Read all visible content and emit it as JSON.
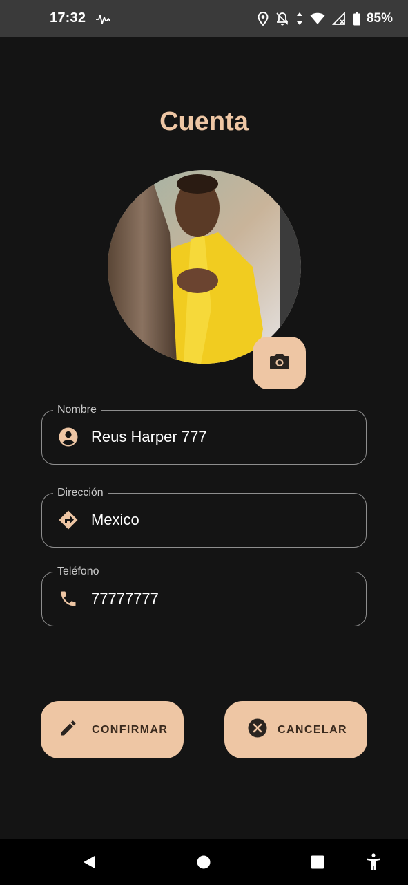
{
  "status_bar": {
    "time": "17:32",
    "battery": "85%",
    "icons": [
      "activity-icon",
      "location-icon",
      "notifications-off-icon",
      "data-arrows-icon",
      "wifi-icon",
      "signal-icon",
      "battery-icon"
    ]
  },
  "page": {
    "title": "Cuenta",
    "avatar_alt": "profile-photo",
    "camera_icon": "camera-icon"
  },
  "form": {
    "nombre": {
      "label": "Nombre",
      "value": "Reus Harper 777",
      "icon": "account-circle-icon"
    },
    "direccion": {
      "label": "Dirección",
      "value": "Mexico",
      "icon": "directions-icon"
    },
    "telefono": {
      "label": "Teléfono",
      "value": "77777777",
      "icon": "phone-icon"
    }
  },
  "actions": {
    "confirm": {
      "label": "CONFIRMAR",
      "icon": "edit-icon"
    },
    "cancel": {
      "label": "CANCELAR",
      "icon": "cancel-icon"
    }
  },
  "nav_bar": {
    "icons": [
      "back-icon",
      "home-icon",
      "recents-icon",
      "accessibility-icon"
    ]
  },
  "colors": {
    "background": "#141414",
    "accent": "#eec6a4",
    "status_bar": "#3a3a3a",
    "field_border": "#8e8e8e"
  }
}
